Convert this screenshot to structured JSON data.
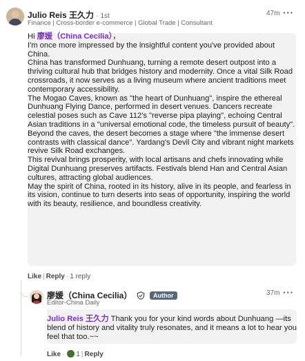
{
  "comment": {
    "author_name": "Julio Reis 王久力",
    "degree": "· 1st",
    "headline": "Finance | Cross-border e-commerce | Global Trade | Consultant",
    "time": "47m",
    "more": "···",
    "body": [
      {
        "pre": "Hi ",
        "mention": "廖媛（China Cecilia）",
        "post": "，"
      },
      {
        "text": "I'm once more impressed by the insightful content you've provided about China."
      },
      {
        "text": "China has transformed Dunhuang, turning a remote desert outpost into a thriving cultural hub that bridges history and modernity. Once a vital Silk Road crossroads, it now serves as a living museum where ancient traditions meet contemporary accessibility."
      },
      {
        "text": "The Mogao Caves, known as \"the heart of Dunhuang\", inspire the ethereal Dunhuang Flying Dance, performed in desert venues. Dancers recreate celestial poses such as Cave 112's \"reverse pipa playing\", echoing Central Asian traditions in a \"universal emotional code, the timeless pursuit of beauty\"."
      },
      {
        "text": "Beyond the caves, the desert becomes a stage where \"the immense desert contrasts with classical dance\". Yardang's Devil City and vibrant night markets revive Silk Road exchanges."
      },
      {
        "text": "This revival brings prosperity, with local artisans and chefs innovating while Digital Dunhuang preserves artifacts. Festivals blend Han and Central Asian cultures, attracting global audiences."
      },
      {
        "text": "May the spirit of China, rooted in its history, alive in its people, and fearless in its vision, continue to turn deserts into seas of opportunity, inspiring the world with its beauty, resilience, and boundless creativity."
      }
    ],
    "actions": {
      "like": "Like",
      "reply": "Reply",
      "reply_count": "1 reply"
    }
  },
  "reply": {
    "author_name": "廖媛（China Cecilia）",
    "author_badge": "Author",
    "headline": "Editor-China Daily",
    "time": "37m",
    "more": "···",
    "mention": "Julio Reis 王久力",
    "text": " Thank you for your kind words about Dunhuang —its blend of history and vitality truly resonates, and it means a lot to hear you feel that too.~~",
    "actions": {
      "like": "Like",
      "reaction_count": "1",
      "reply": "Reply"
    }
  },
  "colors": {
    "mention": "#7a2fc4",
    "badge": "#56687a",
    "bubble": "#f2f2f2",
    "reaction": "#44712e"
  }
}
